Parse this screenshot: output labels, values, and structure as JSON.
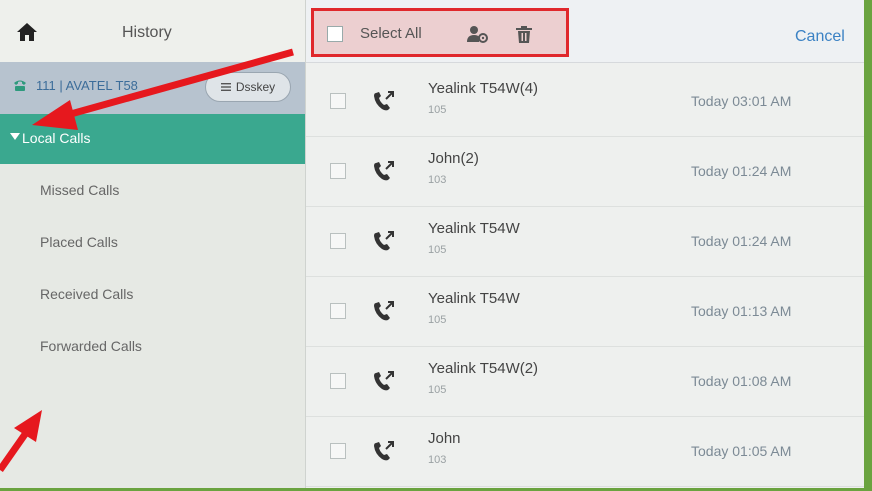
{
  "sidebar": {
    "title": "History",
    "account_label": "111 | AVATEL T58",
    "dsskey_label": "Dsskey",
    "selected_item": "Local Calls",
    "items": [
      "Missed Calls",
      "Placed Calls",
      "Received Calls",
      "Forwarded Calls"
    ]
  },
  "toolbar": {
    "select_all_label": "Select All",
    "cancel_label": "Cancel"
  },
  "calls": [
    {
      "name": "Yealink T54W(4)",
      "number": "105",
      "time": "Today 03:01 AM"
    },
    {
      "name": "John(2)",
      "number": "103",
      "time": "Today 01:24 AM"
    },
    {
      "name": "Yealink T54W",
      "number": "105",
      "time": "Today 01:24 AM"
    },
    {
      "name": "Yealink T54W",
      "number": "105",
      "time": "Today 01:13 AM"
    },
    {
      "name": "Yealink T54W(2)",
      "number": "105",
      "time": "Today 01:08 AM"
    },
    {
      "name": "John",
      "number": "103",
      "time": "Today 01:05 AM"
    }
  ],
  "icons": {
    "home": "home-icon",
    "phone": "phone-icon",
    "dsskey": "menu-lines-icon",
    "contact": "add-contact-icon",
    "delete": "trash-icon",
    "outgoing_call": "outgoing-call-icon"
  },
  "colors": {
    "accent": "#3aa88f",
    "highlight_border": "#e0282c",
    "link": "#3b82c4",
    "frame": "#6aa33f"
  }
}
